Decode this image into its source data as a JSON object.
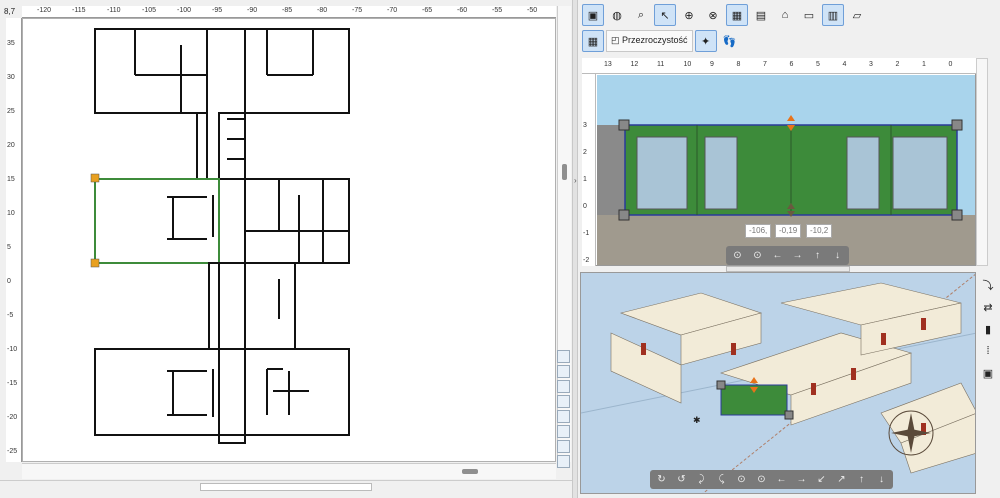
{
  "plan": {
    "corner_value": "8,7",
    "ruler_x": [
      "-120",
      "-115",
      "-110",
      "-105",
      "-100",
      "-95",
      "-90",
      "-85",
      "-80",
      "-75",
      "-70",
      "-65",
      "-60",
      "-55",
      "-50"
    ],
    "ruler_y": [
      "35",
      "30",
      "25",
      "20",
      "15",
      "10",
      "5",
      "0",
      "-5",
      "-10",
      "-15",
      "-20",
      "-25"
    ]
  },
  "right": {
    "toolbar1": [
      "render-icon",
      "texture-icon",
      "zoom-icon",
      "select-icon",
      "add-node-icon",
      "remove-node-icon",
      "wall-icon",
      "window-icon",
      "roof-icon",
      "floor-icon",
      "stair-icon",
      "glass-icon"
    ],
    "transparency_label": "Przezroczystość",
    "elevation": {
      "ruler_x": [
        "13",
        "12",
        "11",
        "10",
        "9",
        "8",
        "7",
        "6",
        "5",
        "4",
        "3",
        "2",
        "1",
        "0"
      ],
      "ruler_y": [
        "3",
        "2",
        "1",
        "0",
        "-1",
        "-2"
      ],
      "coords": [
        "-106,",
        "-0,19",
        "-10,2"
      ]
    },
    "nav_elev": [
      "⊙",
      "⊙",
      "←",
      "→",
      "↑",
      "↓"
    ],
    "nav_3d": [
      "↻",
      "↺",
      "⤸",
      "⤹",
      "⊙",
      "⊙",
      "←",
      "→",
      "↙",
      "↗",
      "↑",
      "↓"
    ]
  },
  "colors": {
    "wall_green": "#3d8b3a",
    "window_blue": "#a9c4d6",
    "sky": "#a9d4ec",
    "ground": "#a09a8e",
    "handle": "#e8731a"
  }
}
